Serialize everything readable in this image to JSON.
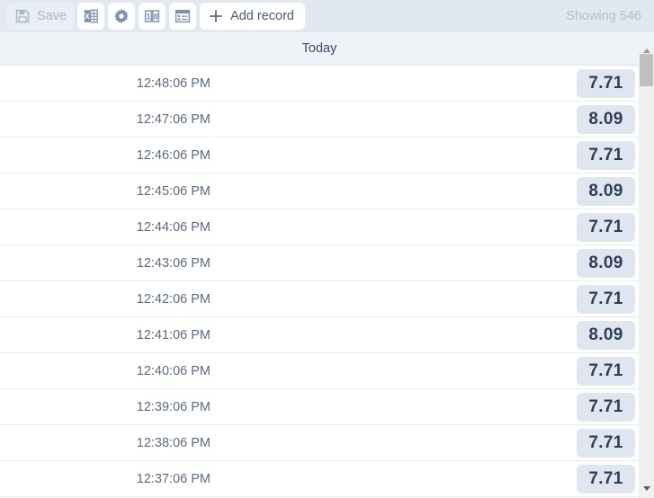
{
  "toolbar": {
    "buttons": [
      {
        "name": "save-button",
        "label": "Save",
        "icon": "floppy-disk-icon",
        "disabled": true,
        "icon_only": false
      },
      {
        "name": "export-excel-button",
        "label": "",
        "icon": "excel-sheet-icon",
        "disabled": false,
        "icon_only": true
      },
      {
        "name": "settings-button",
        "label": "",
        "icon": "gear-icon",
        "disabled": false,
        "icon_only": true
      },
      {
        "name": "digits-button",
        "label": "",
        "icon": "digit-counter-icon",
        "disabled": false,
        "icon_only": true
      },
      {
        "name": "list-view-button",
        "label": "",
        "icon": "list-table-icon",
        "disabled": false,
        "icon_only": true
      },
      {
        "name": "add-record-button",
        "label": "Add record",
        "icon": "plus-icon",
        "disabled": false,
        "icon_only": false
      }
    ],
    "showing_label": "Showing 546"
  },
  "grid": {
    "group_header": "Today",
    "rows": [
      {
        "time": "12:48:06 PM",
        "value": "7.71"
      },
      {
        "time": "12:47:06 PM",
        "value": "8.09"
      },
      {
        "time": "12:46:06 PM",
        "value": "7.71"
      },
      {
        "time": "12:45:06 PM",
        "value": "8.09"
      },
      {
        "time": "12:44:06 PM",
        "value": "7.71"
      },
      {
        "time": "12:43:06 PM",
        "value": "8.09"
      },
      {
        "time": "12:42:06 PM",
        "value": "7.71"
      },
      {
        "time": "12:41:06 PM",
        "value": "8.09"
      },
      {
        "time": "12:40:06 PM",
        "value": "7.71"
      },
      {
        "time": "12:39:06 PM",
        "value": "7.71"
      },
      {
        "time": "12:38:06 PM",
        "value": "7.71"
      },
      {
        "time": "12:37:06 PM",
        "value": "7.71"
      }
    ]
  },
  "scrollbar": {
    "up_arrow": "scroll-up-arrow-icon",
    "down_arrow": "scroll-down-arrow-icon",
    "thumb": "scrollbar-thumb"
  },
  "colors": {
    "toolbar_bg": "#e2e8f0",
    "group_header_bg": "#eef3f8",
    "value_badge_bg": "#dfe6f0",
    "value_text": "#2f3e56",
    "row_text": "#5a6b80",
    "muted_text": "#b2bfcd",
    "icon_blue": "#7d92ae"
  }
}
